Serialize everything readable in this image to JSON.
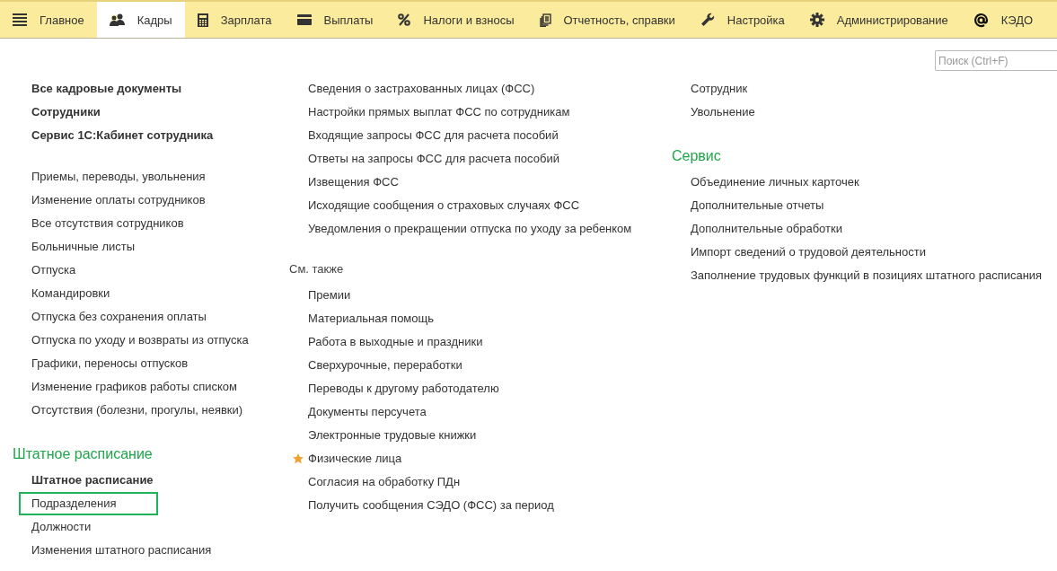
{
  "tabs": [
    {
      "label": "Главное",
      "selected": false
    },
    {
      "label": "Кадры",
      "selected": true
    },
    {
      "label": "Зарплата",
      "selected": false
    },
    {
      "label": "Выплаты",
      "selected": false
    },
    {
      "label": "Налоги и взносы",
      "selected": false
    },
    {
      "label": "Отчетность, справки",
      "selected": false
    },
    {
      "label": "Настройка",
      "selected": false
    },
    {
      "label": "Администрирование",
      "selected": false
    },
    {
      "label": "КЭДО",
      "selected": false
    }
  ],
  "search": {
    "placeholder": "Поиск (Ctrl+F)"
  },
  "columns": [
    {
      "sections": [
        {
          "items": [
            {
              "label": "Все кадровые документы",
              "bold": true,
              "starred": false,
              "focused": false
            },
            {
              "label": "Сотрудники",
              "bold": true,
              "starred": false,
              "focused": false
            },
            {
              "label": "Сервис 1С:Кабинет сотрудника",
              "bold": true,
              "starred": false,
              "focused": false
            }
          ]
        },
        {
          "items": [
            {
              "label": "Приемы, переводы, увольнения",
              "bold": false,
              "starred": false,
              "focused": false
            },
            {
              "label": "Изменение оплаты сотрудников",
              "bold": false,
              "starred": false,
              "focused": false
            },
            {
              "label": "Все отсутствия сотрудников",
              "bold": false,
              "starred": false,
              "focused": false
            },
            {
              "label": "Больничные листы",
              "bold": false,
              "starred": false,
              "focused": false
            },
            {
              "label": "Отпуска",
              "bold": false,
              "starred": false,
              "focused": false
            },
            {
              "label": "Командировки",
              "bold": false,
              "starred": false,
              "focused": false
            },
            {
              "label": "Отпуска без сохранения оплаты",
              "bold": false,
              "starred": false,
              "focused": false
            },
            {
              "label": "Отпуска по уходу и возвраты из отпуска",
              "bold": false,
              "starred": false,
              "focused": false
            },
            {
              "label": "Графики, переносы отпусков",
              "bold": false,
              "starred": false,
              "focused": false
            },
            {
              "label": "Изменение графиков работы списком",
              "bold": false,
              "starred": false,
              "focused": false
            },
            {
              "label": "Отсутствия (болезни, прогулы, неявки)",
              "bold": false,
              "starred": false,
              "focused": false
            }
          ]
        },
        {
          "title": "Штатное расписание",
          "kind": "group",
          "items": [
            {
              "label": "Штатное расписание",
              "bold": true,
              "starred": false,
              "focused": false
            },
            {
              "label": "Подразделения",
              "bold": false,
              "starred": false,
              "focused": true
            },
            {
              "label": "Должности",
              "bold": false,
              "starred": false,
              "focused": false
            },
            {
              "label": "Изменения штатного расписания",
              "bold": false,
              "starred": false,
              "focused": false
            }
          ]
        }
      ]
    },
    {
      "sections": [
        {
          "items": [
            {
              "label": "Сведения о застрахованных лицах (ФСС)",
              "bold": false,
              "starred": false,
              "focused": false
            },
            {
              "label": "Настройки прямых выплат ФСС по сотрудникам",
              "bold": false,
              "starred": false,
              "focused": false
            },
            {
              "label": "Входящие запросы ФСС для расчета пособий",
              "bold": false,
              "starred": false,
              "focused": false
            },
            {
              "label": "Ответы на запросы ФСС для расчета пособий",
              "bold": false,
              "starred": false,
              "focused": false
            },
            {
              "label": "Извещения ФСС",
              "bold": false,
              "starred": false,
              "focused": false
            },
            {
              "label": "Исходящие сообщения о страховых случаях ФСС",
              "bold": false,
              "starred": false,
              "focused": false
            },
            {
              "label": "Уведомления о прекращении отпуска по уходу за ребенком",
              "bold": false,
              "starred": false,
              "focused": false
            }
          ]
        },
        {
          "title": "См. также",
          "kind": "see-also",
          "items": [
            {
              "label": "Премии",
              "bold": false,
              "starred": false,
              "focused": false
            },
            {
              "label": "Материальная помощь",
              "bold": false,
              "starred": false,
              "focused": false
            },
            {
              "label": "Работа в выходные и праздники",
              "bold": false,
              "starred": false,
              "focused": false
            },
            {
              "label": "Сверхурочные, переработки",
              "bold": false,
              "starred": false,
              "focused": false
            },
            {
              "label": "Переводы к другому работодателю",
              "bold": false,
              "starred": false,
              "focused": false
            },
            {
              "label": "Документы персучета",
              "bold": false,
              "starred": false,
              "focused": false
            },
            {
              "label": "Электронные трудовые книжки",
              "bold": false,
              "starred": false,
              "focused": false
            },
            {
              "label": "Физические лица",
              "bold": false,
              "starred": true,
              "focused": false
            },
            {
              "label": "Согласия на обработку ПДн",
              "bold": false,
              "starred": false,
              "focused": false
            },
            {
              "label": "Получить сообщения СЭДО (ФСС) за период",
              "bold": false,
              "starred": false,
              "focused": false
            }
          ]
        }
      ]
    },
    {
      "sections": [
        {
          "items": [
            {
              "label": "Сотрудник",
              "bold": false,
              "starred": false,
              "focused": false
            },
            {
              "label": "Увольнение",
              "bold": false,
              "starred": false,
              "focused": false
            }
          ]
        },
        {
          "title": "Сервис",
          "kind": "group",
          "items": [
            {
              "label": "Объединение личных карточек",
              "bold": false,
              "starred": false,
              "focused": false
            },
            {
              "label": "Дополнительные отчеты",
              "bold": false,
              "starred": false,
              "focused": false
            },
            {
              "label": "Дополнительные обработки",
              "bold": false,
              "starred": false,
              "focused": false
            },
            {
              "label": "Импорт сведений о трудовой деятельности",
              "bold": false,
              "starred": false,
              "focused": false
            },
            {
              "label": "Заполнение трудовых функций в позициях штатного расписания",
              "bold": false,
              "starred": false,
              "focused": false
            }
          ]
        }
      ]
    }
  ]
}
